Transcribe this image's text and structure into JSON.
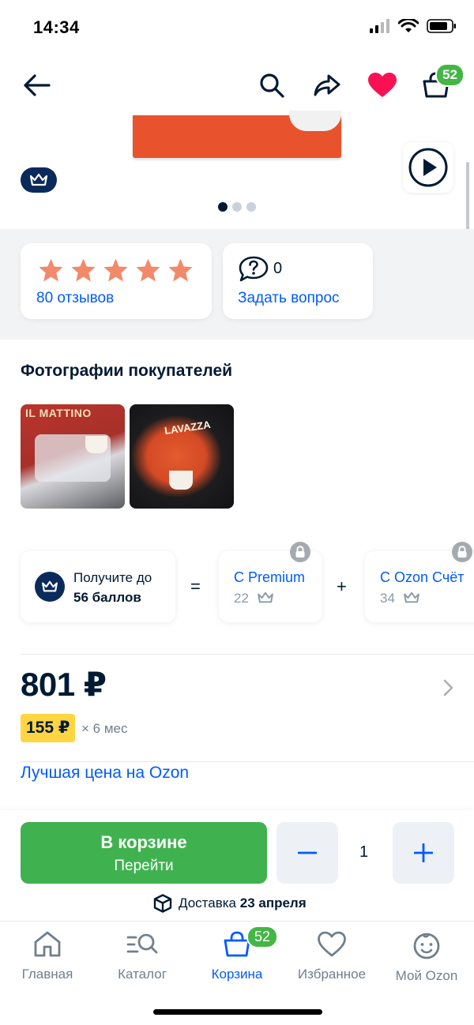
{
  "status_bar": {
    "time": "14:34"
  },
  "top_nav": {
    "cart_count": "52"
  },
  "gallery": {
    "slides_total": 3,
    "active_slide": 1
  },
  "rating": {
    "stars": 5,
    "reviews_label": "80 отзывов"
  },
  "questions": {
    "count": "0",
    "ask_label": "Задать вопрос"
  },
  "customer_photos": {
    "title": "Фотографии покупателей",
    "photo_1_text": "IL MATTINO",
    "photo_2_text": "LAVAZZA"
  },
  "points": {
    "get_line1": "Получите до",
    "get_line2": "56 баллов",
    "equals": "=",
    "plus": "+",
    "premium_title": "С Premium",
    "premium_value": "22",
    "account_title": "С Ozon Счёт",
    "account_value": "34"
  },
  "price": {
    "main": "801 ₽",
    "installment": "155 ₽",
    "installment_suffix": "× 6 мес",
    "best_price_link": "Лучшая цена на Ozon"
  },
  "cta": {
    "in_cart": "В корзине",
    "go": "Перейти",
    "quantity": "1",
    "minus": "−",
    "plus": "+",
    "delivery_prefix": "Доставка ",
    "delivery_date": "23 апреля"
  },
  "tabbar": {
    "home": "Главная",
    "catalog": "Каталог",
    "cart": "Корзина",
    "cart_badge": "52",
    "favorites": "Избранное",
    "my_ozon": "Мой Ozon"
  },
  "colors": {
    "brand_blue": "#005bff",
    "dark_navy": "#001a34",
    "green": "#3fb24f",
    "star": "#f2896b",
    "favorite_red": "#f91155",
    "installment_yellow": "#ffd641"
  }
}
